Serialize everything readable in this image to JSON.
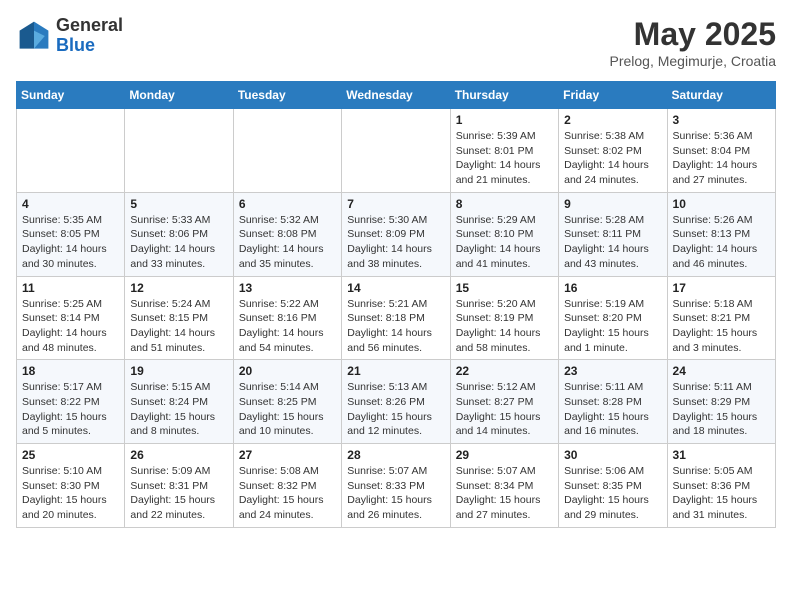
{
  "header": {
    "logo": {
      "general": "General",
      "blue": "Blue"
    },
    "month_year": "May 2025",
    "location": "Prelog, Megimurje, Croatia"
  },
  "days_of_week": [
    "Sunday",
    "Monday",
    "Tuesday",
    "Wednesday",
    "Thursday",
    "Friday",
    "Saturday"
  ],
  "weeks": [
    [
      {
        "day": "",
        "info": ""
      },
      {
        "day": "",
        "info": ""
      },
      {
        "day": "",
        "info": ""
      },
      {
        "day": "",
        "info": ""
      },
      {
        "day": "1",
        "info": "Sunrise: 5:39 AM\nSunset: 8:01 PM\nDaylight: 14 hours and 21 minutes."
      },
      {
        "day": "2",
        "info": "Sunrise: 5:38 AM\nSunset: 8:02 PM\nDaylight: 14 hours and 24 minutes."
      },
      {
        "day": "3",
        "info": "Sunrise: 5:36 AM\nSunset: 8:04 PM\nDaylight: 14 hours and 27 minutes."
      }
    ],
    [
      {
        "day": "4",
        "info": "Sunrise: 5:35 AM\nSunset: 8:05 PM\nDaylight: 14 hours and 30 minutes."
      },
      {
        "day": "5",
        "info": "Sunrise: 5:33 AM\nSunset: 8:06 PM\nDaylight: 14 hours and 33 minutes."
      },
      {
        "day": "6",
        "info": "Sunrise: 5:32 AM\nSunset: 8:08 PM\nDaylight: 14 hours and 35 minutes."
      },
      {
        "day": "7",
        "info": "Sunrise: 5:30 AM\nSunset: 8:09 PM\nDaylight: 14 hours and 38 minutes."
      },
      {
        "day": "8",
        "info": "Sunrise: 5:29 AM\nSunset: 8:10 PM\nDaylight: 14 hours and 41 minutes."
      },
      {
        "day": "9",
        "info": "Sunrise: 5:28 AM\nSunset: 8:11 PM\nDaylight: 14 hours and 43 minutes."
      },
      {
        "day": "10",
        "info": "Sunrise: 5:26 AM\nSunset: 8:13 PM\nDaylight: 14 hours and 46 minutes."
      }
    ],
    [
      {
        "day": "11",
        "info": "Sunrise: 5:25 AM\nSunset: 8:14 PM\nDaylight: 14 hours and 48 minutes."
      },
      {
        "day": "12",
        "info": "Sunrise: 5:24 AM\nSunset: 8:15 PM\nDaylight: 14 hours and 51 minutes."
      },
      {
        "day": "13",
        "info": "Sunrise: 5:22 AM\nSunset: 8:16 PM\nDaylight: 14 hours and 54 minutes."
      },
      {
        "day": "14",
        "info": "Sunrise: 5:21 AM\nSunset: 8:18 PM\nDaylight: 14 hours and 56 minutes."
      },
      {
        "day": "15",
        "info": "Sunrise: 5:20 AM\nSunset: 8:19 PM\nDaylight: 14 hours and 58 minutes."
      },
      {
        "day": "16",
        "info": "Sunrise: 5:19 AM\nSunset: 8:20 PM\nDaylight: 15 hours and 1 minute."
      },
      {
        "day": "17",
        "info": "Sunrise: 5:18 AM\nSunset: 8:21 PM\nDaylight: 15 hours and 3 minutes."
      }
    ],
    [
      {
        "day": "18",
        "info": "Sunrise: 5:17 AM\nSunset: 8:22 PM\nDaylight: 15 hours and 5 minutes."
      },
      {
        "day": "19",
        "info": "Sunrise: 5:15 AM\nSunset: 8:24 PM\nDaylight: 15 hours and 8 minutes."
      },
      {
        "day": "20",
        "info": "Sunrise: 5:14 AM\nSunset: 8:25 PM\nDaylight: 15 hours and 10 minutes."
      },
      {
        "day": "21",
        "info": "Sunrise: 5:13 AM\nSunset: 8:26 PM\nDaylight: 15 hours and 12 minutes."
      },
      {
        "day": "22",
        "info": "Sunrise: 5:12 AM\nSunset: 8:27 PM\nDaylight: 15 hours and 14 minutes."
      },
      {
        "day": "23",
        "info": "Sunrise: 5:11 AM\nSunset: 8:28 PM\nDaylight: 15 hours and 16 minutes."
      },
      {
        "day": "24",
        "info": "Sunrise: 5:11 AM\nSunset: 8:29 PM\nDaylight: 15 hours and 18 minutes."
      }
    ],
    [
      {
        "day": "25",
        "info": "Sunrise: 5:10 AM\nSunset: 8:30 PM\nDaylight: 15 hours and 20 minutes."
      },
      {
        "day": "26",
        "info": "Sunrise: 5:09 AM\nSunset: 8:31 PM\nDaylight: 15 hours and 22 minutes."
      },
      {
        "day": "27",
        "info": "Sunrise: 5:08 AM\nSunset: 8:32 PM\nDaylight: 15 hours and 24 minutes."
      },
      {
        "day": "28",
        "info": "Sunrise: 5:07 AM\nSunset: 8:33 PM\nDaylight: 15 hours and 26 minutes."
      },
      {
        "day": "29",
        "info": "Sunrise: 5:07 AM\nSunset: 8:34 PM\nDaylight: 15 hours and 27 minutes."
      },
      {
        "day": "30",
        "info": "Sunrise: 5:06 AM\nSunset: 8:35 PM\nDaylight: 15 hours and 29 minutes."
      },
      {
        "day": "31",
        "info": "Sunrise: 5:05 AM\nSunset: 8:36 PM\nDaylight: 15 hours and 31 minutes."
      }
    ]
  ]
}
